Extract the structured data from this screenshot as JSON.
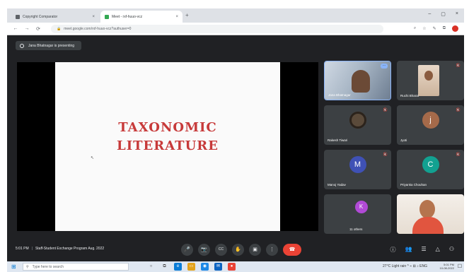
{
  "browser": {
    "tabs": [
      {
        "label": "Copyright Comparator",
        "favicon_color": "#5f6368",
        "close": "×"
      },
      {
        "label": "Meet - rxf-huuo-vcz",
        "favicon_color": "#34a853",
        "close": "×"
      }
    ],
    "new_tab": "+",
    "window_controls": [
      "–",
      "▢",
      "×"
    ],
    "nav": {
      "back": "←",
      "forward": "→",
      "reload": "⟳"
    },
    "url": "meet.google.com/rxf-huuo-vcz?authuser=0",
    "lock": "🔒",
    "extensions": [
      "⌕",
      "☆",
      "✎",
      "⧉"
    ]
  },
  "meet": {
    "presenting_text": "Jana Bhatnagar is presenting",
    "slide": {
      "line1": "TAXONOMIC",
      "line2": "LITERATURE"
    },
    "cursor": "↖",
    "participants": [
      {
        "name": "Jana Bhatnagar",
        "kind": "video",
        "active": true
      },
      {
        "name": "Ruchi Bharat",
        "kind": "video"
      },
      {
        "name": "Rakesh Tiwari",
        "kind": "photo",
        "color": "#5a4a3a"
      },
      {
        "name": "Jyoti",
        "kind": "initial",
        "initial": "j",
        "color": "#a56a4a"
      },
      {
        "name": "Manoj Yadav",
        "kind": "initial",
        "initial": "M",
        "color": "#3f51b5"
      },
      {
        "name": "Priyanka Chouhan",
        "kind": "initial",
        "initial": "C",
        "color": "#12a191"
      },
      {
        "name": "11 others",
        "kind": "group",
        "initial": "K",
        "color": "#b14ad6"
      },
      {
        "name": "",
        "kind": "self"
      }
    ],
    "mic_muted": "🔇",
    "more": "⋯",
    "bottom": {
      "time": "5:01 PM",
      "meeting_title": "Staff-Student Exchange Program Aug. 2022",
      "controls": [
        "🎤",
        "📷",
        "CC",
        "✋",
        "▣",
        "⋮"
      ],
      "end_call": "☎",
      "right": [
        "ⓘ",
        "👥",
        "☰",
        "△",
        "⚇"
      ]
    }
  },
  "taskbar": {
    "start": "⊞",
    "search_placeholder": "Type here to search",
    "search_icon": "⚲",
    "apps": [
      {
        "glyph": "○",
        "color": "#6b6b6b"
      },
      {
        "glyph": "⧉",
        "color": "#4a4a4a"
      },
      {
        "glyph": "e",
        "color": "#0a7cd6"
      },
      {
        "glyph": "▭",
        "color": "#e3a21a"
      },
      {
        "glyph": "◉",
        "color": "#1e88e5"
      },
      {
        "glyph": "✉",
        "color": "#0b63c1"
      },
      {
        "glyph": "●",
        "color": "#e94235"
      }
    ],
    "tray_text": "27°C Light rain ^ ⌁ ⊞ ♪ ENG",
    "time": "5:01 PM",
    "date": "10-08-2022",
    "notification": "☐"
  }
}
